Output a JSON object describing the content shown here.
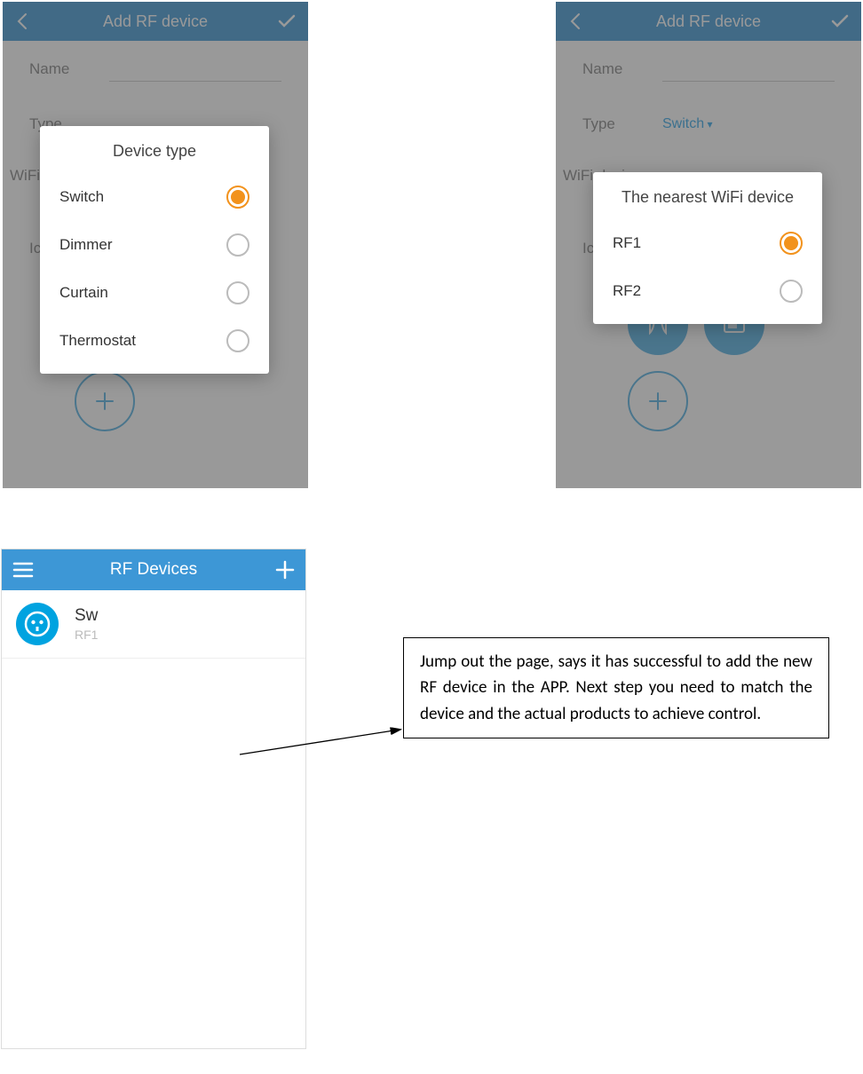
{
  "screens": {
    "add": {
      "title": "Add RF device",
      "fields": {
        "name_label": "Name",
        "type_label": "Type",
        "type_value": "Switch",
        "wifi_label": "WiFi device",
        "icon_label": "Icon"
      }
    },
    "list": {
      "title": "RF Devices",
      "items": [
        {
          "name": "Sw",
          "sub": "RF1"
        }
      ]
    }
  },
  "modals": {
    "device_type": {
      "title": "Device type",
      "options": [
        {
          "label": "Switch",
          "selected": true
        },
        {
          "label": "Dimmer",
          "selected": false
        },
        {
          "label": "Curtain",
          "selected": false
        },
        {
          "label": "Thermostat",
          "selected": false
        }
      ]
    },
    "nearest_wifi": {
      "title": "The nearest WiFi device",
      "options": [
        {
          "label": "RF1",
          "selected": true
        },
        {
          "label": "RF2",
          "selected": false
        }
      ]
    }
  },
  "callout": {
    "text": "Jump out the page, says it has successful to add the new RF device in the APP. Next step you need to match the device and the actual products to achieve control."
  }
}
